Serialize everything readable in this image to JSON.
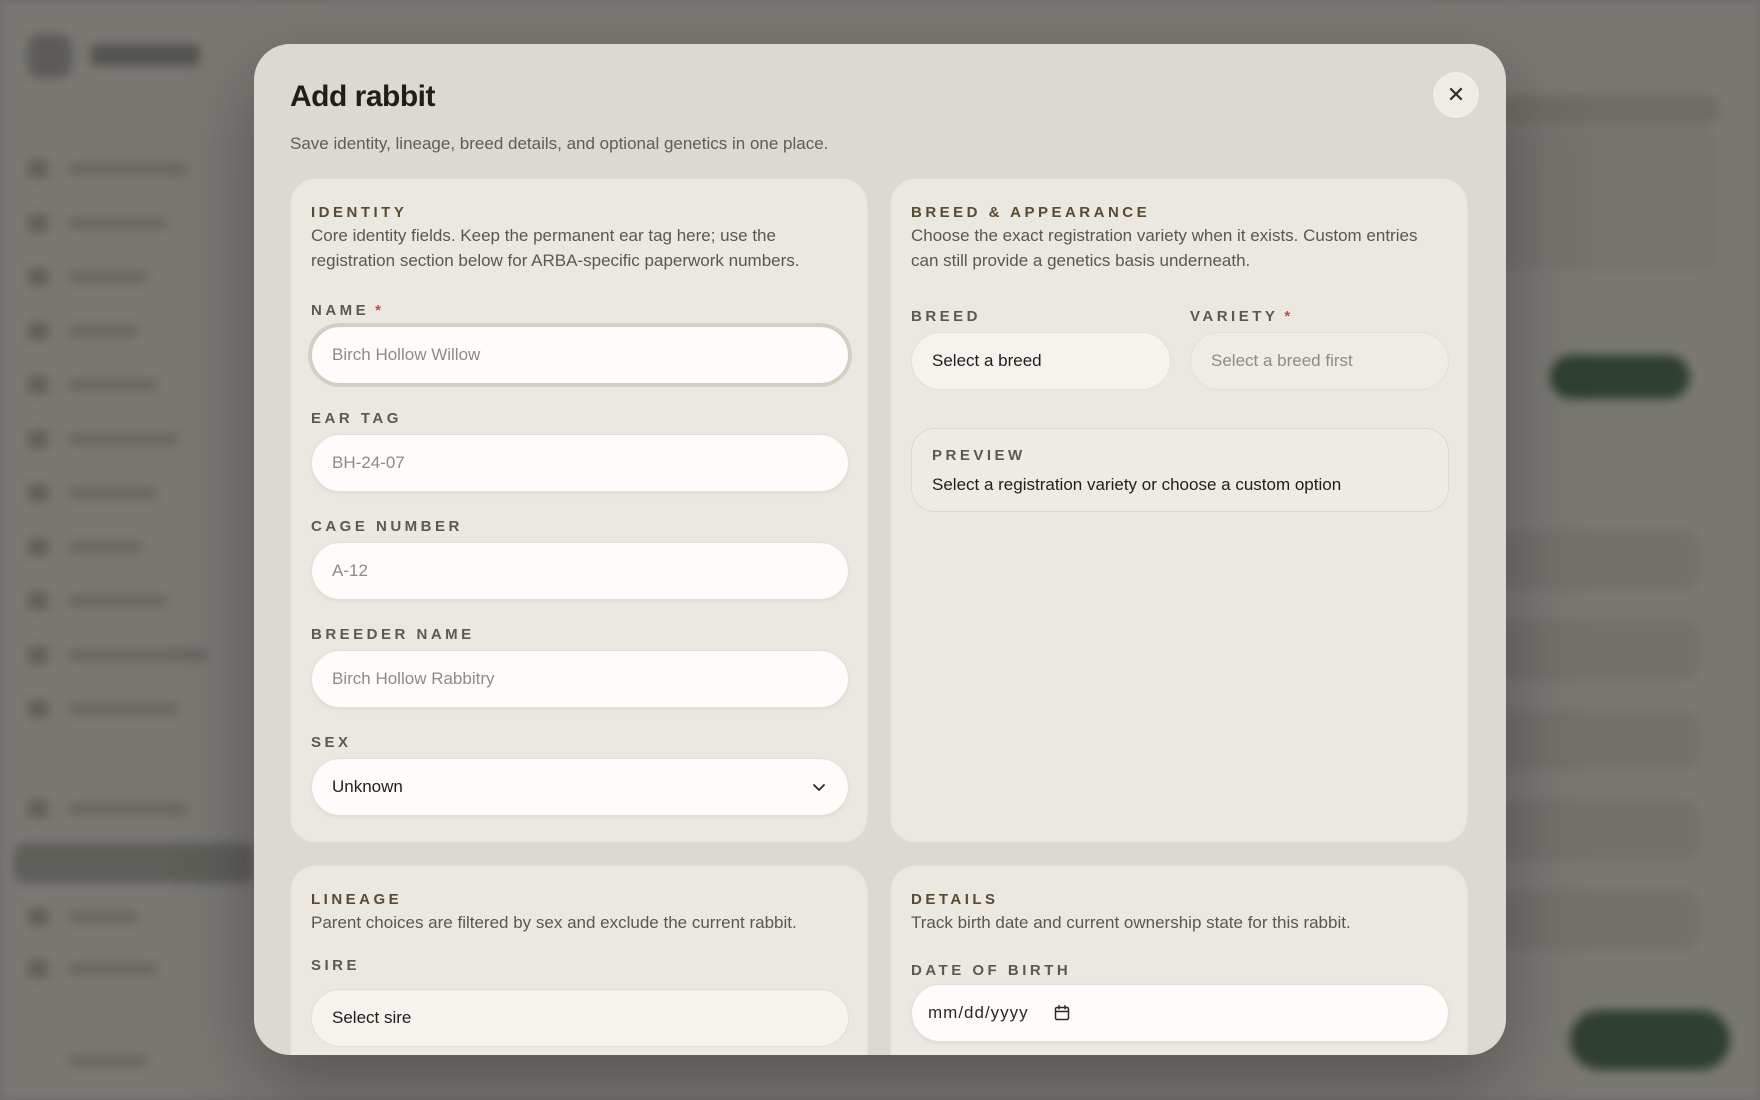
{
  "modal": {
    "title": "Add rabbit",
    "subtitle": "Save identity, lineage, breed details, and optional genetics in one place.",
    "close_icon": "close-icon",
    "close_glyph": "✕"
  },
  "identity": {
    "heading": "IDENTITY",
    "description": "Core identity fields. Keep the permanent ear tag here; use the registration section below for ARBA-specific paperwork numbers.",
    "name": {
      "label": "NAME",
      "required": "*",
      "placeholder": "Birch Hollow Willow",
      "value": ""
    },
    "ear_tag": {
      "label": "EAR TAG",
      "placeholder": "BH-24-07",
      "value": ""
    },
    "cage_number": {
      "label": "CAGE NUMBER",
      "placeholder": "A-12",
      "value": ""
    },
    "breeder_name": {
      "label": "BREEDER NAME",
      "placeholder": "Birch Hollow Rabbitry",
      "value": ""
    },
    "sex": {
      "label": "SEX",
      "value": "Unknown"
    }
  },
  "breed": {
    "heading": "BREED & APPEARANCE",
    "description": "Choose the exact registration variety when it exists. Custom entries can still provide a genetics basis underneath.",
    "breed_field": {
      "label": "BREED",
      "value": "Select a breed"
    },
    "variety_field": {
      "label": "VARIETY",
      "required": "*",
      "value": "Select a breed first"
    },
    "preview": {
      "label": "PREVIEW",
      "text": "Select a registration variety or choose a custom option"
    }
  },
  "lineage": {
    "heading": "LINEAGE",
    "description": "Parent choices are filtered by sex and exclude the current rabbit.",
    "sire": {
      "label": "SIRE",
      "value": "Select sire"
    }
  },
  "details": {
    "heading": "DETAILS",
    "description": "Track birth date and current ownership state for this rabbit.",
    "dob": {
      "label": "DATE OF BIRTH",
      "value": "mm/dd/yyyy"
    }
  },
  "colors": {
    "accent": "#5a4a33",
    "required": "#b0514a",
    "modal_bg": "#dcd9d2",
    "card_bg": "#ebe8e1"
  }
}
